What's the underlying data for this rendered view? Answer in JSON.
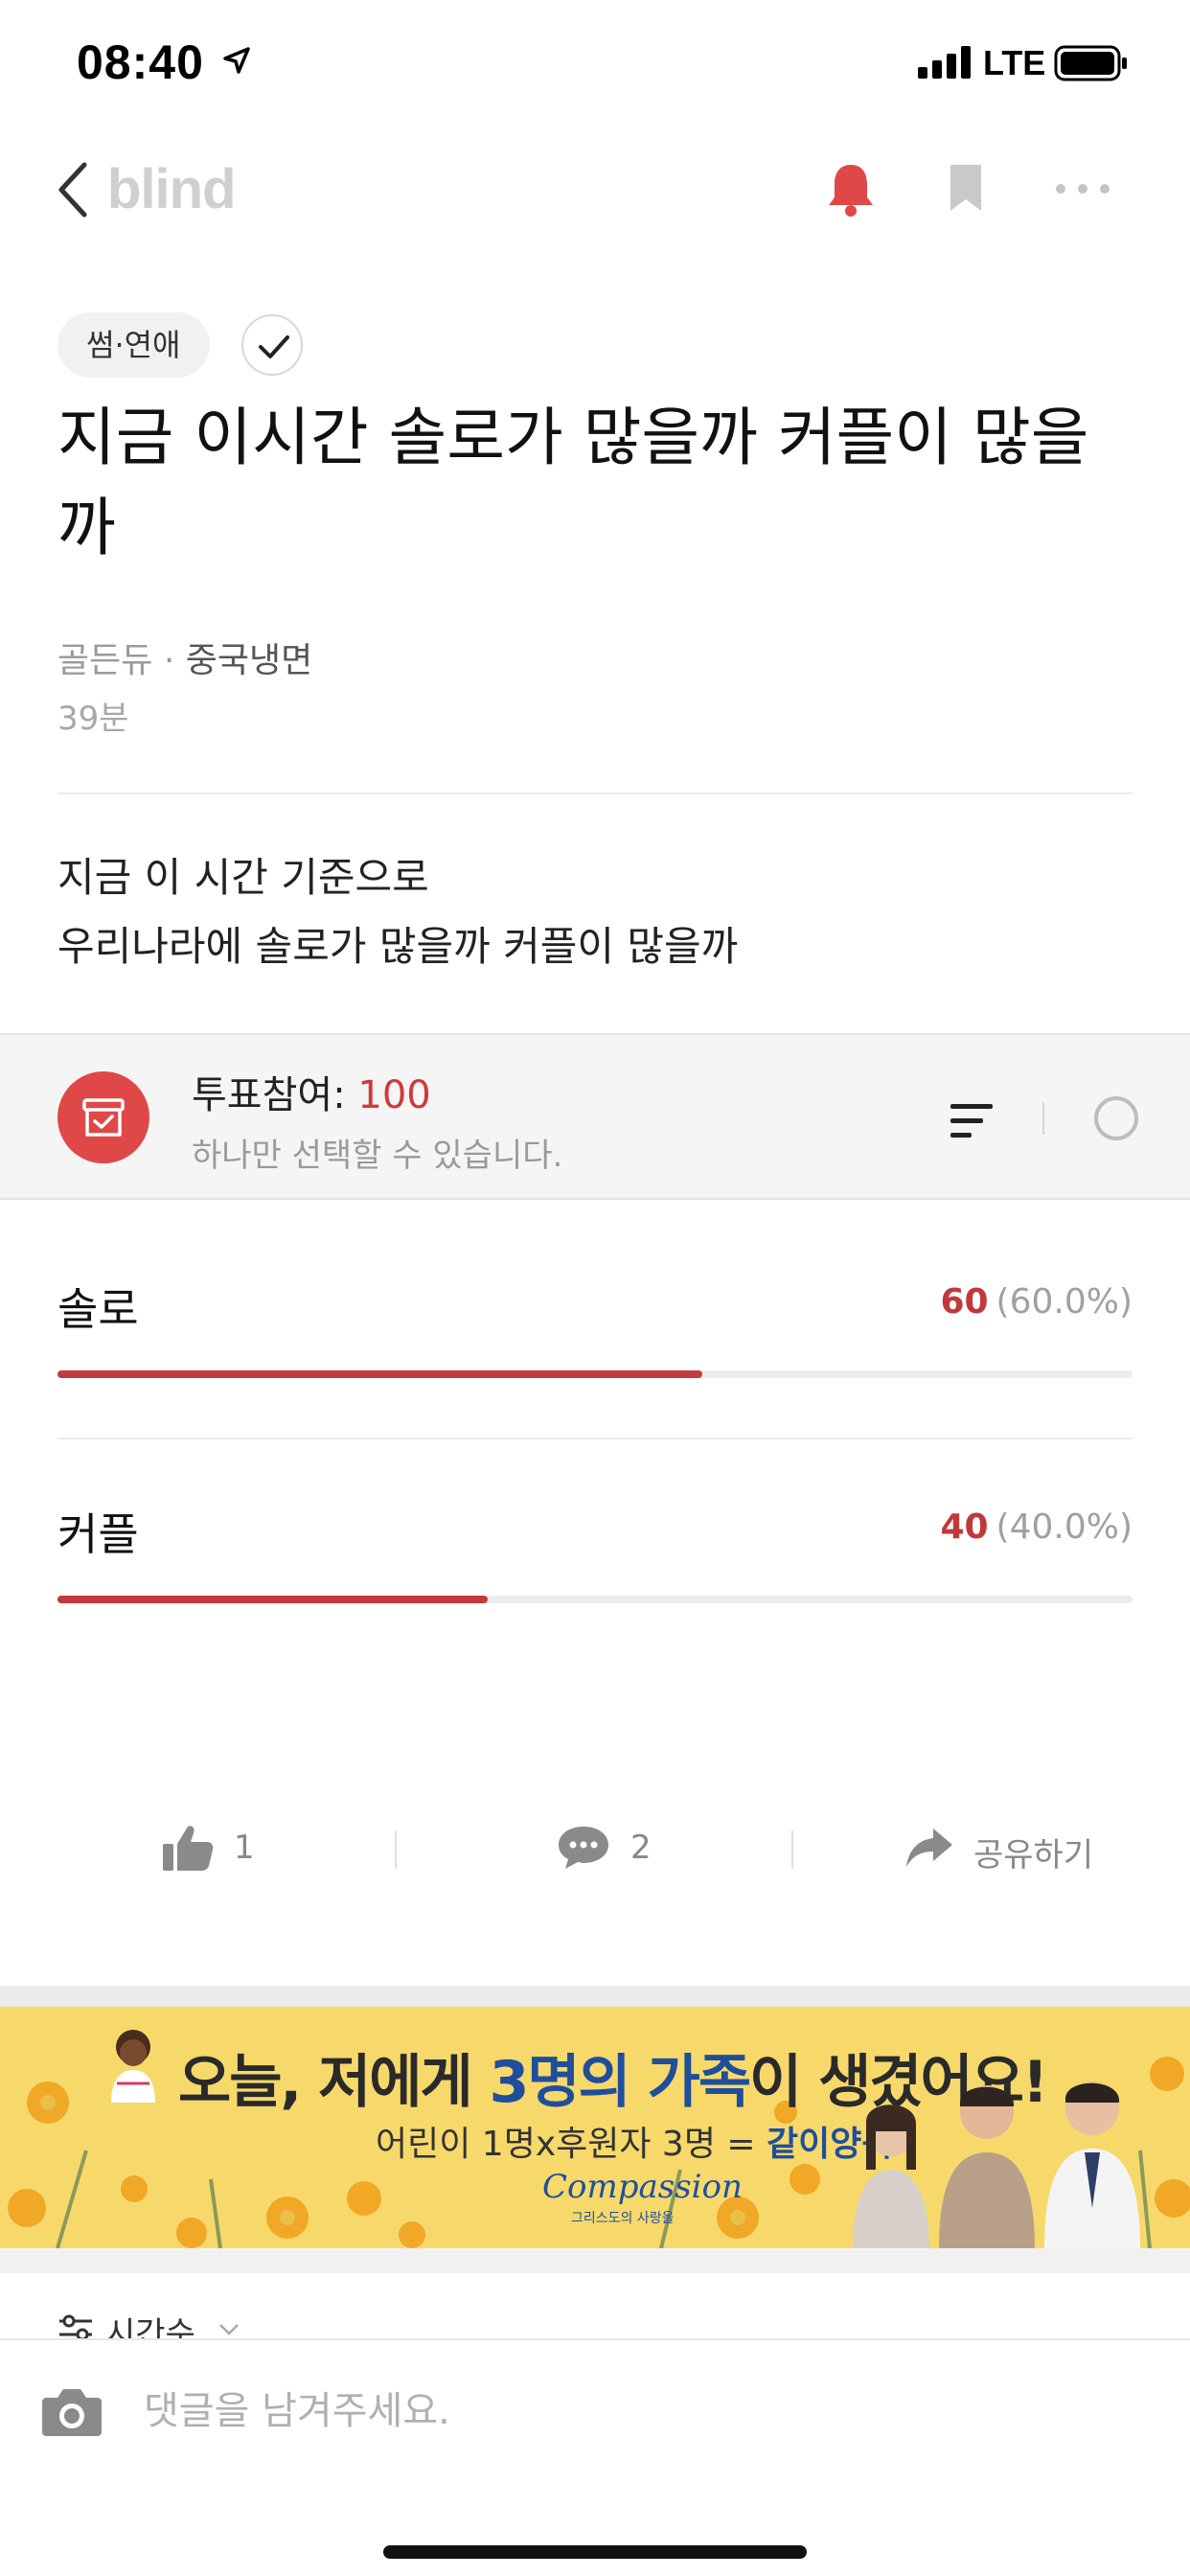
{
  "status_bar": {
    "time": "08:40",
    "network": "LTE"
  },
  "nav": {
    "brand": "blind",
    "accent": "#e04848"
  },
  "post": {
    "category": "썸·연애",
    "title": "지금 이시간 솔로가 많을까 커플이 많을까",
    "company": "골든듀",
    "separator": "·",
    "nickname": "중국냉면",
    "age": "39분",
    "body_line1": "지금 이 시간 기준으로",
    "body_line2": "우리나라에 솔로가 많을까 커플이 많을까"
  },
  "poll": {
    "participation_label": "투표참여: ",
    "participation_count": "100",
    "hint": "하나만 선택할 수 있습니다.",
    "bar_color": "#c33a3c",
    "options": [
      {
        "label": "솔로",
        "votes": "60",
        "percent_text": "(60.0%)",
        "fraction": 0.6
      },
      {
        "label": "커플",
        "votes": "40",
        "percent_text": "(40.0%)",
        "fraction": 0.4
      }
    ]
  },
  "actions": {
    "likes": "1",
    "comments": "2",
    "share_label": "공유하기"
  },
  "ad": {
    "headline_a": "오늘, 저에게 ",
    "headline_b": "3명의 가족",
    "headline_c": "이 생겼어요!",
    "sub_a": "어린이 1명x후원자 3명 = ",
    "sub_b": "같이양육",
    "logo": "Compassion",
    "logo_tagline": "그리스도의 사랑을"
  },
  "comments": {
    "sort_label": "시간순",
    "input_placeholder": "댓글을 남겨주세요."
  }
}
